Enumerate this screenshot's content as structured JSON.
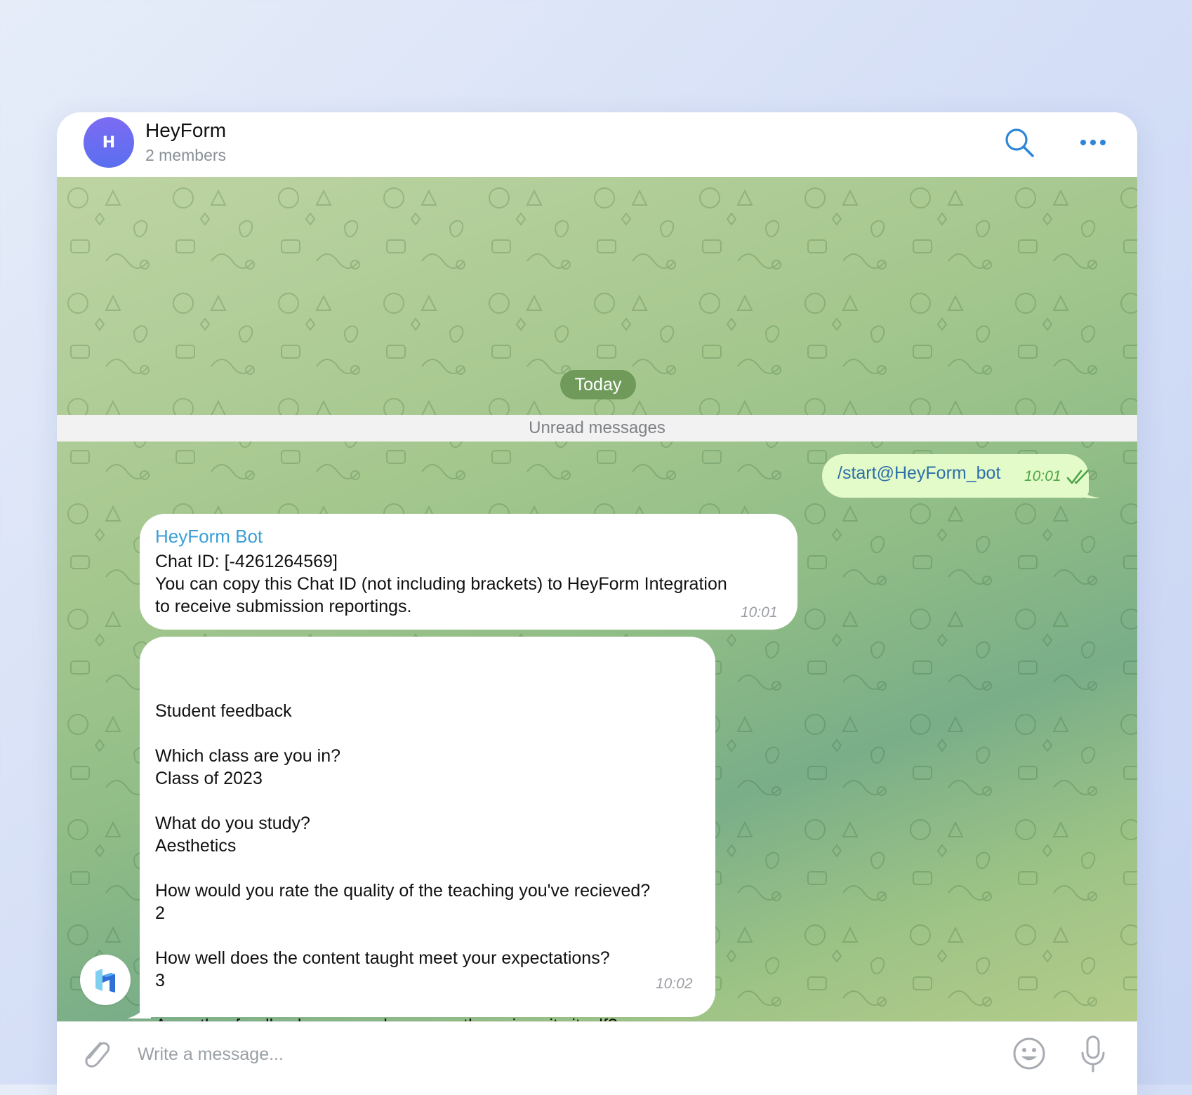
{
  "header": {
    "avatar_letter": "H",
    "title": "HeyForm",
    "subtitle": "2 members"
  },
  "chat": {
    "date_pill": "Today",
    "unread_label": "Unread messages",
    "outgoing": {
      "text": "/start@HeyForm_bot",
      "time": "10:01"
    },
    "bot_message": {
      "sender": "HeyForm Bot",
      "lines": [
        "Chat ID: [-4261264569]",
        "You can copy this Chat ID (not including brackets) to HeyForm Integration",
        "to receive submission reportings."
      ],
      "time": "10:01"
    },
    "form_message": {
      "lines": [
        "Student feedback",
        "",
        "Which class are you in?",
        "Class of 2023",
        "",
        "What do you study?",
        "Aesthetics",
        "",
        "How would you rate the quality of the teaching you've recieved?",
        "2",
        "",
        "How well does the content taught meet your expectations?",
        "3",
        "",
        "Any other feedback on your classes, or the university itself?"
      ],
      "time": "10:02"
    }
  },
  "composer": {
    "placeholder": "Write a message..."
  },
  "colors": {
    "accent": "#2f86d6",
    "sender_name": "#3a9fd6",
    "outgoing_bubble": "#e3fbc8",
    "date_pill": "#6f9a5a"
  },
  "icons": {
    "search": "search-icon",
    "more": "more-icon",
    "attach": "paperclip-icon",
    "emoji": "emoji-icon",
    "mic": "microphone-icon",
    "read_status": "double-check-icon"
  }
}
